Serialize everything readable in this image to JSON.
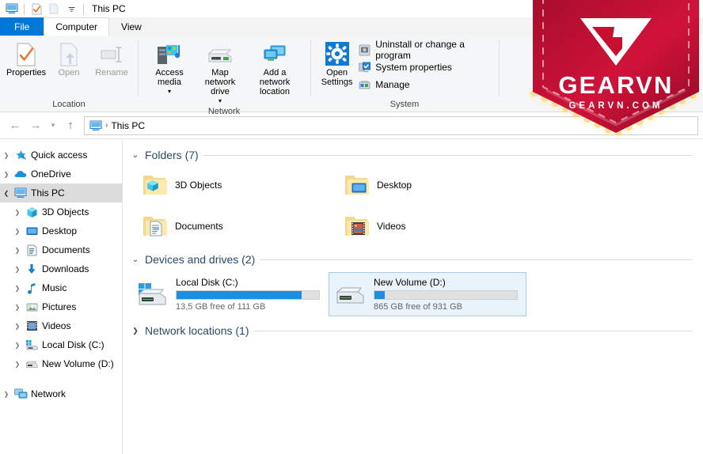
{
  "window": {
    "title": "This PC",
    "quick_access_icons": [
      "this-pc-icon",
      "properties-icon",
      "new-folder-icon",
      "customize-chevron-icon"
    ]
  },
  "ribbon": {
    "tabs": [
      {
        "label": "File",
        "state": "file"
      },
      {
        "label": "Computer",
        "state": "active"
      },
      {
        "label": "View",
        "state": "normal"
      }
    ],
    "groups": [
      {
        "label": "Location",
        "buttons": [
          {
            "label": "Properties",
            "icon": "properties-icon",
            "enabled": true
          },
          {
            "label": "Open",
            "icon": "open-icon",
            "enabled": false
          },
          {
            "label": "Rename",
            "icon": "rename-icon",
            "enabled": false
          }
        ]
      },
      {
        "label": "Network",
        "buttons": [
          {
            "label": "Access media",
            "icon": "access-media-icon",
            "enabled": true,
            "dropdown": true
          },
          {
            "label": "Map network drive",
            "icon": "map-network-drive-icon",
            "enabled": true,
            "dropdown": true
          },
          {
            "label": "Add a network location",
            "icon": "add-network-location-icon",
            "enabled": true,
            "dropdown": false
          }
        ]
      },
      {
        "label": "System",
        "big_button": {
          "label": "Open Settings",
          "icon": "settings-gear-icon"
        },
        "small_buttons": [
          {
            "label": "Uninstall or change a program",
            "icon": "uninstall-program-icon"
          },
          {
            "label": "System properties",
            "icon": "system-properties-icon"
          },
          {
            "label": "Manage",
            "icon": "manage-icon"
          }
        ]
      }
    ]
  },
  "navbar": {
    "back": "back-arrow-icon",
    "forward": "forward-arrow-icon",
    "recent": "recent-locations-chevron-icon",
    "up": "up-arrow-icon",
    "address_icon": "this-pc-icon",
    "breadcrumb": "This PC"
  },
  "sidebar": {
    "items": [
      {
        "label": "Quick access",
        "icon": "star-pin-icon",
        "indent": 0,
        "expanded": false,
        "selected": false
      },
      {
        "label": "OneDrive",
        "icon": "onedrive-cloud-icon",
        "indent": 0,
        "expanded": false,
        "selected": false
      },
      {
        "label": "This PC",
        "icon": "this-pc-icon",
        "indent": 0,
        "expanded": true,
        "selected": true
      },
      {
        "label": "3D Objects",
        "icon": "3d-objects-icon",
        "indent": 1,
        "expanded": false,
        "selected": false
      },
      {
        "label": "Desktop",
        "icon": "desktop-icon",
        "indent": 1,
        "expanded": false,
        "selected": false
      },
      {
        "label": "Documents",
        "icon": "documents-icon",
        "indent": 1,
        "expanded": false,
        "selected": false
      },
      {
        "label": "Downloads",
        "icon": "downloads-icon",
        "indent": 1,
        "expanded": false,
        "selected": false
      },
      {
        "label": "Music",
        "icon": "music-note-icon",
        "indent": 1,
        "expanded": false,
        "selected": false
      },
      {
        "label": "Pictures",
        "icon": "pictures-icon",
        "indent": 1,
        "expanded": false,
        "selected": false
      },
      {
        "label": "Videos",
        "icon": "videos-icon",
        "indent": 1,
        "expanded": false,
        "selected": false
      },
      {
        "label": "Local Disk (C:)",
        "icon": "local-disk-icon",
        "indent": 1,
        "expanded": false,
        "selected": false
      },
      {
        "label": "New Volume (D:)",
        "icon": "drive-icon",
        "indent": 1,
        "expanded": false,
        "selected": false
      },
      {
        "label": "Network",
        "icon": "network-icon",
        "indent": 0,
        "expanded": false,
        "selected": false
      }
    ]
  },
  "content": {
    "folders_section": {
      "title": "Folders (7)",
      "expanded": true,
      "items": [
        {
          "name": "3D Objects",
          "icon": "folder-3d-objects-icon"
        },
        {
          "name": "Desktop",
          "icon": "folder-desktop-icon"
        },
        {
          "name": "Documents",
          "icon": "folder-documents-icon"
        },
        {
          "name": "Videos",
          "icon": "folder-videos-icon"
        }
      ]
    },
    "drives_section": {
      "title": "Devices and drives (2)",
      "expanded": true,
      "items": [
        {
          "name": "Local Disk (C:)",
          "icon": "local-disk-windows-icon",
          "free_text": "13,5 GB free of 111 GB",
          "used_percent": 88,
          "selected": false
        },
        {
          "name": "New Volume (D:)",
          "icon": "drive-icon",
          "free_text": "865 GB free of 931 GB",
          "used_percent": 7,
          "selected": true
        }
      ]
    },
    "network_section": {
      "title": "Network locations (1)",
      "expanded": false
    }
  },
  "watermark": {
    "brand": "GEARVN",
    "site": "GEARVN.COM",
    "color": "#c8102e"
  }
}
